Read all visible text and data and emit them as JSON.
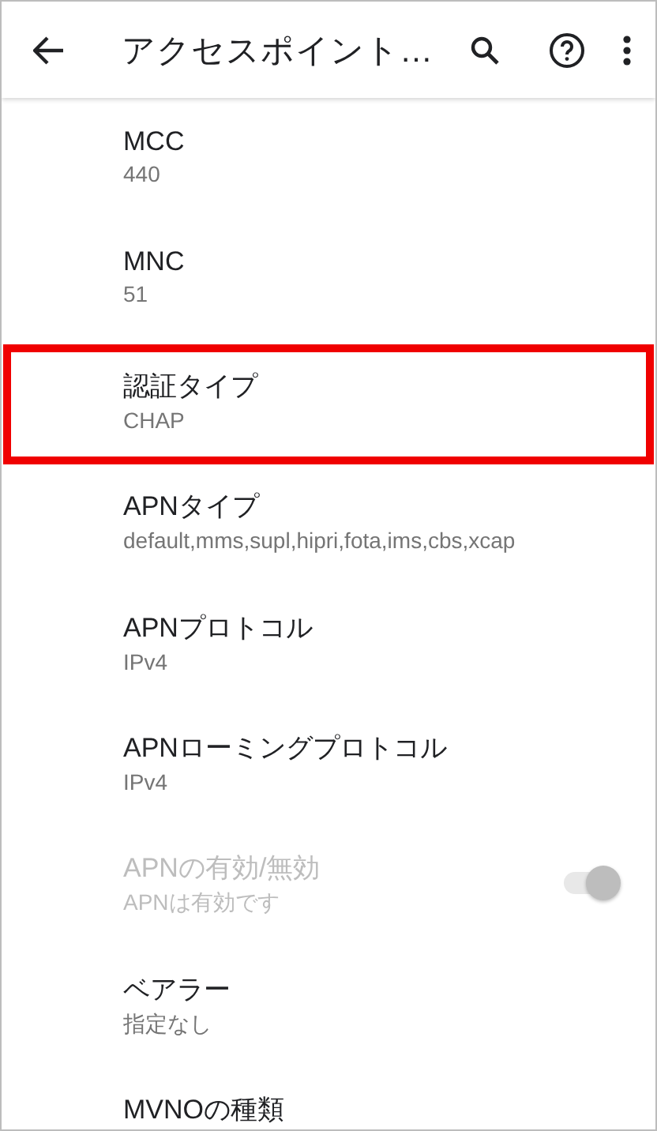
{
  "app_bar": {
    "title": "アクセスポイント…"
  },
  "settings": [
    {
      "kind": "text",
      "title": "MCC",
      "summary": "440",
      "disabled": false,
      "highlighted": false
    },
    {
      "kind": "text",
      "title": "MNC",
      "summary": "51",
      "disabled": false,
      "highlighted": false
    },
    {
      "kind": "text",
      "title": "認証タイプ",
      "summary": "CHAP",
      "disabled": false,
      "highlighted": true
    },
    {
      "kind": "text",
      "title": "APNタイプ",
      "summary": "default,mms,supl,hipri,fota,ims,cbs,xcap",
      "disabled": false,
      "highlighted": false
    },
    {
      "kind": "text",
      "title": "APNプロトコル",
      "summary": "IPv4",
      "disabled": false,
      "highlighted": false
    },
    {
      "kind": "text",
      "title": "APNローミングプロトコル",
      "summary": "IPv4",
      "disabled": false,
      "highlighted": false
    },
    {
      "kind": "switch",
      "title": "APNの有効/無効",
      "summary": "APNは有効です",
      "disabled": true,
      "checked": true,
      "highlighted": false
    },
    {
      "kind": "text",
      "title": "ベアラー",
      "summary": "指定なし",
      "disabled": false,
      "highlighted": false
    },
    {
      "kind": "text",
      "title": "MVNOの種類",
      "disabled": false,
      "highlighted": false
    }
  ]
}
